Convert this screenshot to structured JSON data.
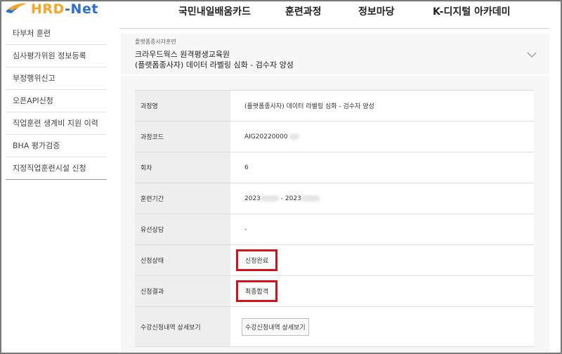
{
  "header": {
    "logo_left": "HRD",
    "logo_right": "-Net",
    "nav": [
      {
        "label": "국민내일배움카드"
      },
      {
        "label": "훈련과정"
      },
      {
        "label": "정보마당"
      },
      {
        "label": "K-디지털 아카데미"
      }
    ]
  },
  "sidebar": {
    "items": [
      {
        "label": "타부처 훈련"
      },
      {
        "label": "심사평가위원 정보등록"
      },
      {
        "label": "부정행위신고"
      },
      {
        "label": "오픈API신청"
      },
      {
        "label": "직업훈련 생계비 지원 이력"
      },
      {
        "label": "BHA 평가검증"
      },
      {
        "label": "지정직업훈련시설 신청"
      }
    ]
  },
  "course": {
    "category": "플랫폼종사자훈련",
    "institution": "크라우드웍스 원격평생교육원",
    "name": "(플랫폼종사자) 데이터 라벨링 심화 - 검수자 양성"
  },
  "details": {
    "rows": [
      {
        "label": "과정명",
        "value": "(플랫폼종사자) 데이터 라벨링 심화 - 검수자 양성"
      },
      {
        "label": "과정코드",
        "value": "AIG20220000"
      },
      {
        "label": "회차",
        "value": "6"
      },
      {
        "label": "훈련기간",
        "start_prefix": "2023",
        "separator": " - ",
        "end_prefix": "2023"
      },
      {
        "label": "유선상담",
        "value": "-"
      },
      {
        "label": "신청상태",
        "value": "신청완료"
      },
      {
        "label": "신청결과",
        "value": "최종합격"
      },
      {
        "label": "수강신청내역 상세보기",
        "button_label": "수강신청내역 상세보기"
      }
    ]
  },
  "colors": {
    "highlight_box": "#d4121b",
    "logo_orange": "#f5a623",
    "logo_blue": "#2a6fd6"
  }
}
